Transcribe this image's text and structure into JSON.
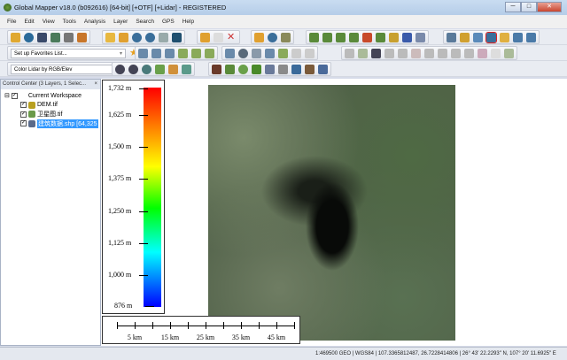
{
  "window": {
    "title": "Global Mapper v18.0 (b092616) [64-bit] [+OTF] [+Lidar] - REGISTERED",
    "minimize": "─",
    "maximize": "□",
    "close": "✕"
  },
  "menu": [
    "File",
    "Edit",
    "View",
    "Tools",
    "Analysis",
    "Layer",
    "Search",
    "GPS",
    "Help"
  ],
  "toolbars": {
    "favorites_select": "Set up Favorites List...",
    "lidar_color_select": "Color Lidar by RGB/Elev"
  },
  "control_center": {
    "title": "Control Center (3 Layers, 1 Selec...",
    "close": "×",
    "workspace": "Current Workspace",
    "layers": [
      {
        "name": "DEM.tif",
        "checked": true
      },
      {
        "name": "卫星图.tif",
        "checked": true
      },
      {
        "name": "建筑数据.shp [64,325",
        "checked": true,
        "selected": true
      }
    ]
  },
  "legend": {
    "labels": [
      "1,732 m",
      "1,625 m",
      "1,500 m",
      "1,375 m",
      "1,250 m",
      "1,125 m",
      "1,000 m",
      "876 m"
    ],
    "colors": [
      "#ff0000",
      "#ff8000",
      "#ffff00",
      "#00ff00",
      "#00ffff",
      "#0000ff"
    ]
  },
  "scale_bar": {
    "labels": [
      "5 km",
      "15 km",
      "25 km",
      "35 km",
      "45 km"
    ]
  },
  "status": {
    "text": "1:469500  GEO | WGS84 | 107.3365812487, 26.7228414806 | 26° 43' 22.2293\" N, 107° 20' 11.6925\" E"
  }
}
